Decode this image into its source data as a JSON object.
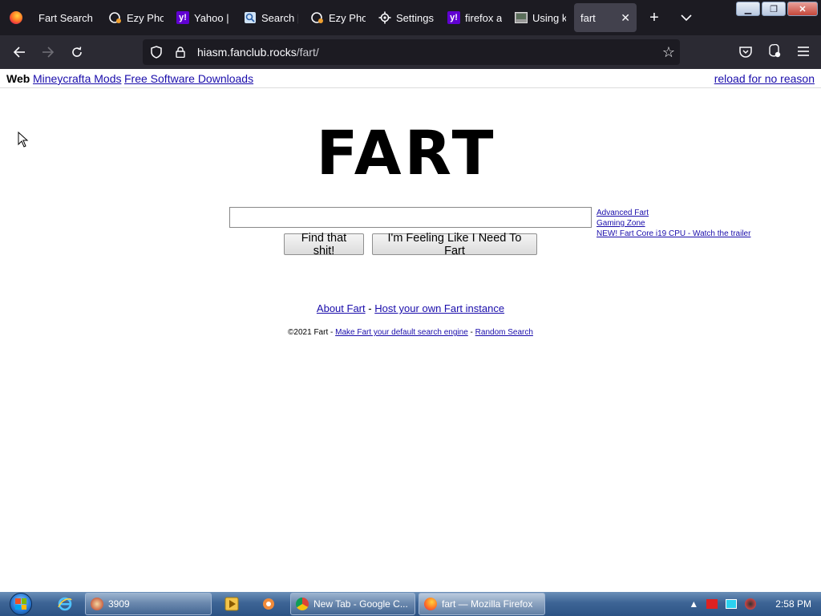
{
  "browser": {
    "tabs": [
      {
        "label": "Fart Search",
        "icon": "none"
      },
      {
        "label": "Ezy Pho",
        "icon": "ezy-photo-icon"
      },
      {
        "label": "Yahoo |",
        "icon": "yahoo-icon"
      },
      {
        "label": "Search |",
        "icon": "search-icon"
      },
      {
        "label": "Ezy Pho",
        "icon": "ezy-photo-icon"
      },
      {
        "label": "Settings",
        "icon": "gear-icon"
      },
      {
        "label": "firefox a",
        "icon": "yahoo-icon"
      },
      {
        "label": "Using k",
        "icon": "image-icon"
      },
      {
        "label": "fart",
        "icon": "none",
        "active": true
      }
    ],
    "new_tab": "+",
    "tab_list": "⌄",
    "url_host": "hiasm.fanclub.rocks",
    "url_path": "/fart/"
  },
  "page": {
    "web_label": "Web",
    "top_links": [
      "Mineycrafta Mods",
      "Free Software Downloads"
    ],
    "reload_link": "reload for no reason",
    "logo": "FART",
    "search": {
      "value": "",
      "placeholder": ""
    },
    "side_links": [
      "Advanced Fart",
      "Gaming Zone",
      "NEW! Fart Core i19 CPU - Watch the trailer"
    ],
    "buttons": {
      "search": "Find that shit!",
      "lucky": "I'm Feeling Like I Need To Fart"
    },
    "about": {
      "about_link": "About Fart",
      "sep": "-",
      "host_link": "Host your own Fart instance"
    },
    "footer": {
      "copyright": "©2021 Fart -",
      "default_link": "Make Fart your default search engine",
      "sep": "-",
      "random_link": "Random Search"
    }
  },
  "taskbar": {
    "tasks": [
      {
        "label": "3909"
      },
      {
        "label": "New Tab - Google C..."
      },
      {
        "label": "fart — Mozilla Firefox",
        "active": true
      }
    ],
    "clock": "2:58 PM"
  },
  "colors": {
    "link": "#1a0dab",
    "tab_bg": "#1c1b22",
    "nav_bg": "#2b2a33",
    "taskbar": "#3d6495"
  }
}
